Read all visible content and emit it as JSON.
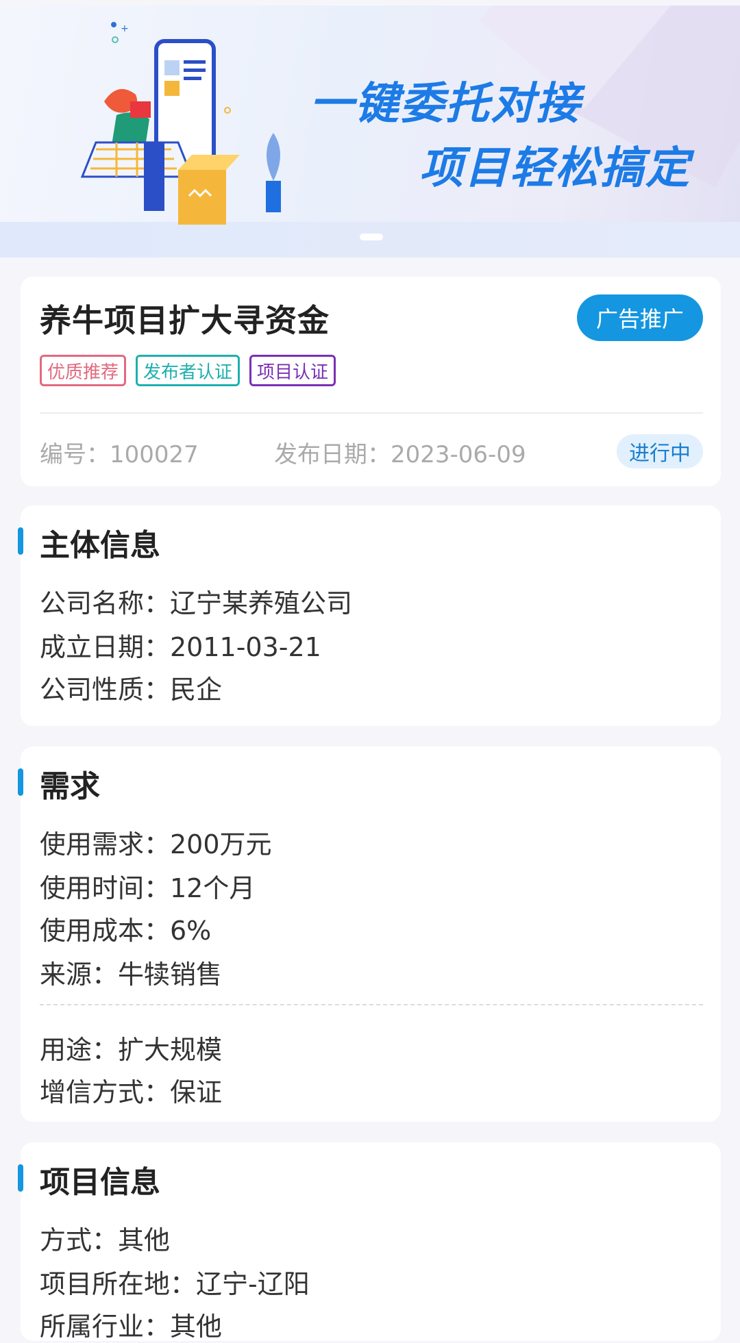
{
  "banner": {
    "slogan_line1": "一键委托对接",
    "slogan_line2": "项目轻松搞定"
  },
  "project": {
    "title": "养牛项目扩大寻资金",
    "ad_button": "广告推广",
    "tags": [
      "优质推荐",
      "发布者认证",
      "项目认证"
    ],
    "id_label": "编号：100027",
    "date_label": "发布日期：2023-06-09",
    "status": "进行中"
  },
  "subject": {
    "title": "主体信息",
    "rows": [
      "公司名称：辽宁某养殖公司",
      "成立日期：2011-03-21",
      "公司性质：民企"
    ]
  },
  "demand": {
    "title": "需求",
    "rows": [
      "使用需求：200万元",
      "使用时间：12个月",
      "使用成本：6%",
      "来源：牛犊销售"
    ],
    "rows2": [
      "用途：扩大规模",
      "增信方式：保证"
    ]
  },
  "project_info": {
    "title": "项目信息",
    "rows": [
      "方式：其他",
      "项目所在地：辽宁-辽阳",
      "所属行业：其他"
    ]
  },
  "colors": {
    "accent": "#1496e0",
    "tag_quality": "#e2697f",
    "tag_publisher": "#1eb0ad",
    "tag_project": "#7a2fb5"
  }
}
